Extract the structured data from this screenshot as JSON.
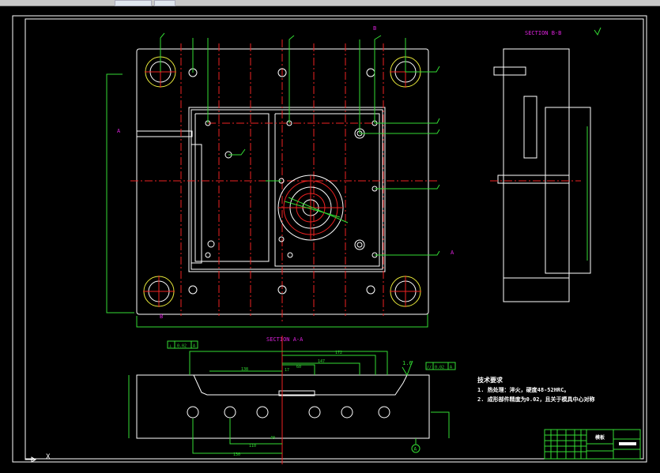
{
  "colors": {
    "background": "#000000",
    "outline": "#ffffff",
    "dimension": "#33dd33",
    "centerline": "#ee2222",
    "section_label": "#dd22dd",
    "bushing": "#e8e83a"
  },
  "drawing": {
    "section_bb_title": "SECTION B-B",
    "section_aa_title": "SECTION A-A",
    "roughness_top": "1.6",
    "tolerance_left": {
      "symbol": "⊥",
      "value": "0.02",
      "datum": "A"
    },
    "tolerance_right": {
      "symbol": "//",
      "value": "0.02",
      "datum": "A"
    },
    "datum_label": "A",
    "section_markers": [
      "A",
      "A",
      "B",
      "B"
    ],
    "dims_aa": [
      "172",
      "147",
      "138",
      "60",
      "40",
      "17",
      "110",
      "130"
    ]
  },
  "notes": {
    "title": "技术要求",
    "items": [
      "1. 热处理：淬火，硬度48-52HRC。",
      "2. 成形部件精度为0.02，且关于模具中心对称"
    ]
  },
  "title_block": {
    "part_name": "模板"
  },
  "ucs": {
    "x_label": "X"
  }
}
